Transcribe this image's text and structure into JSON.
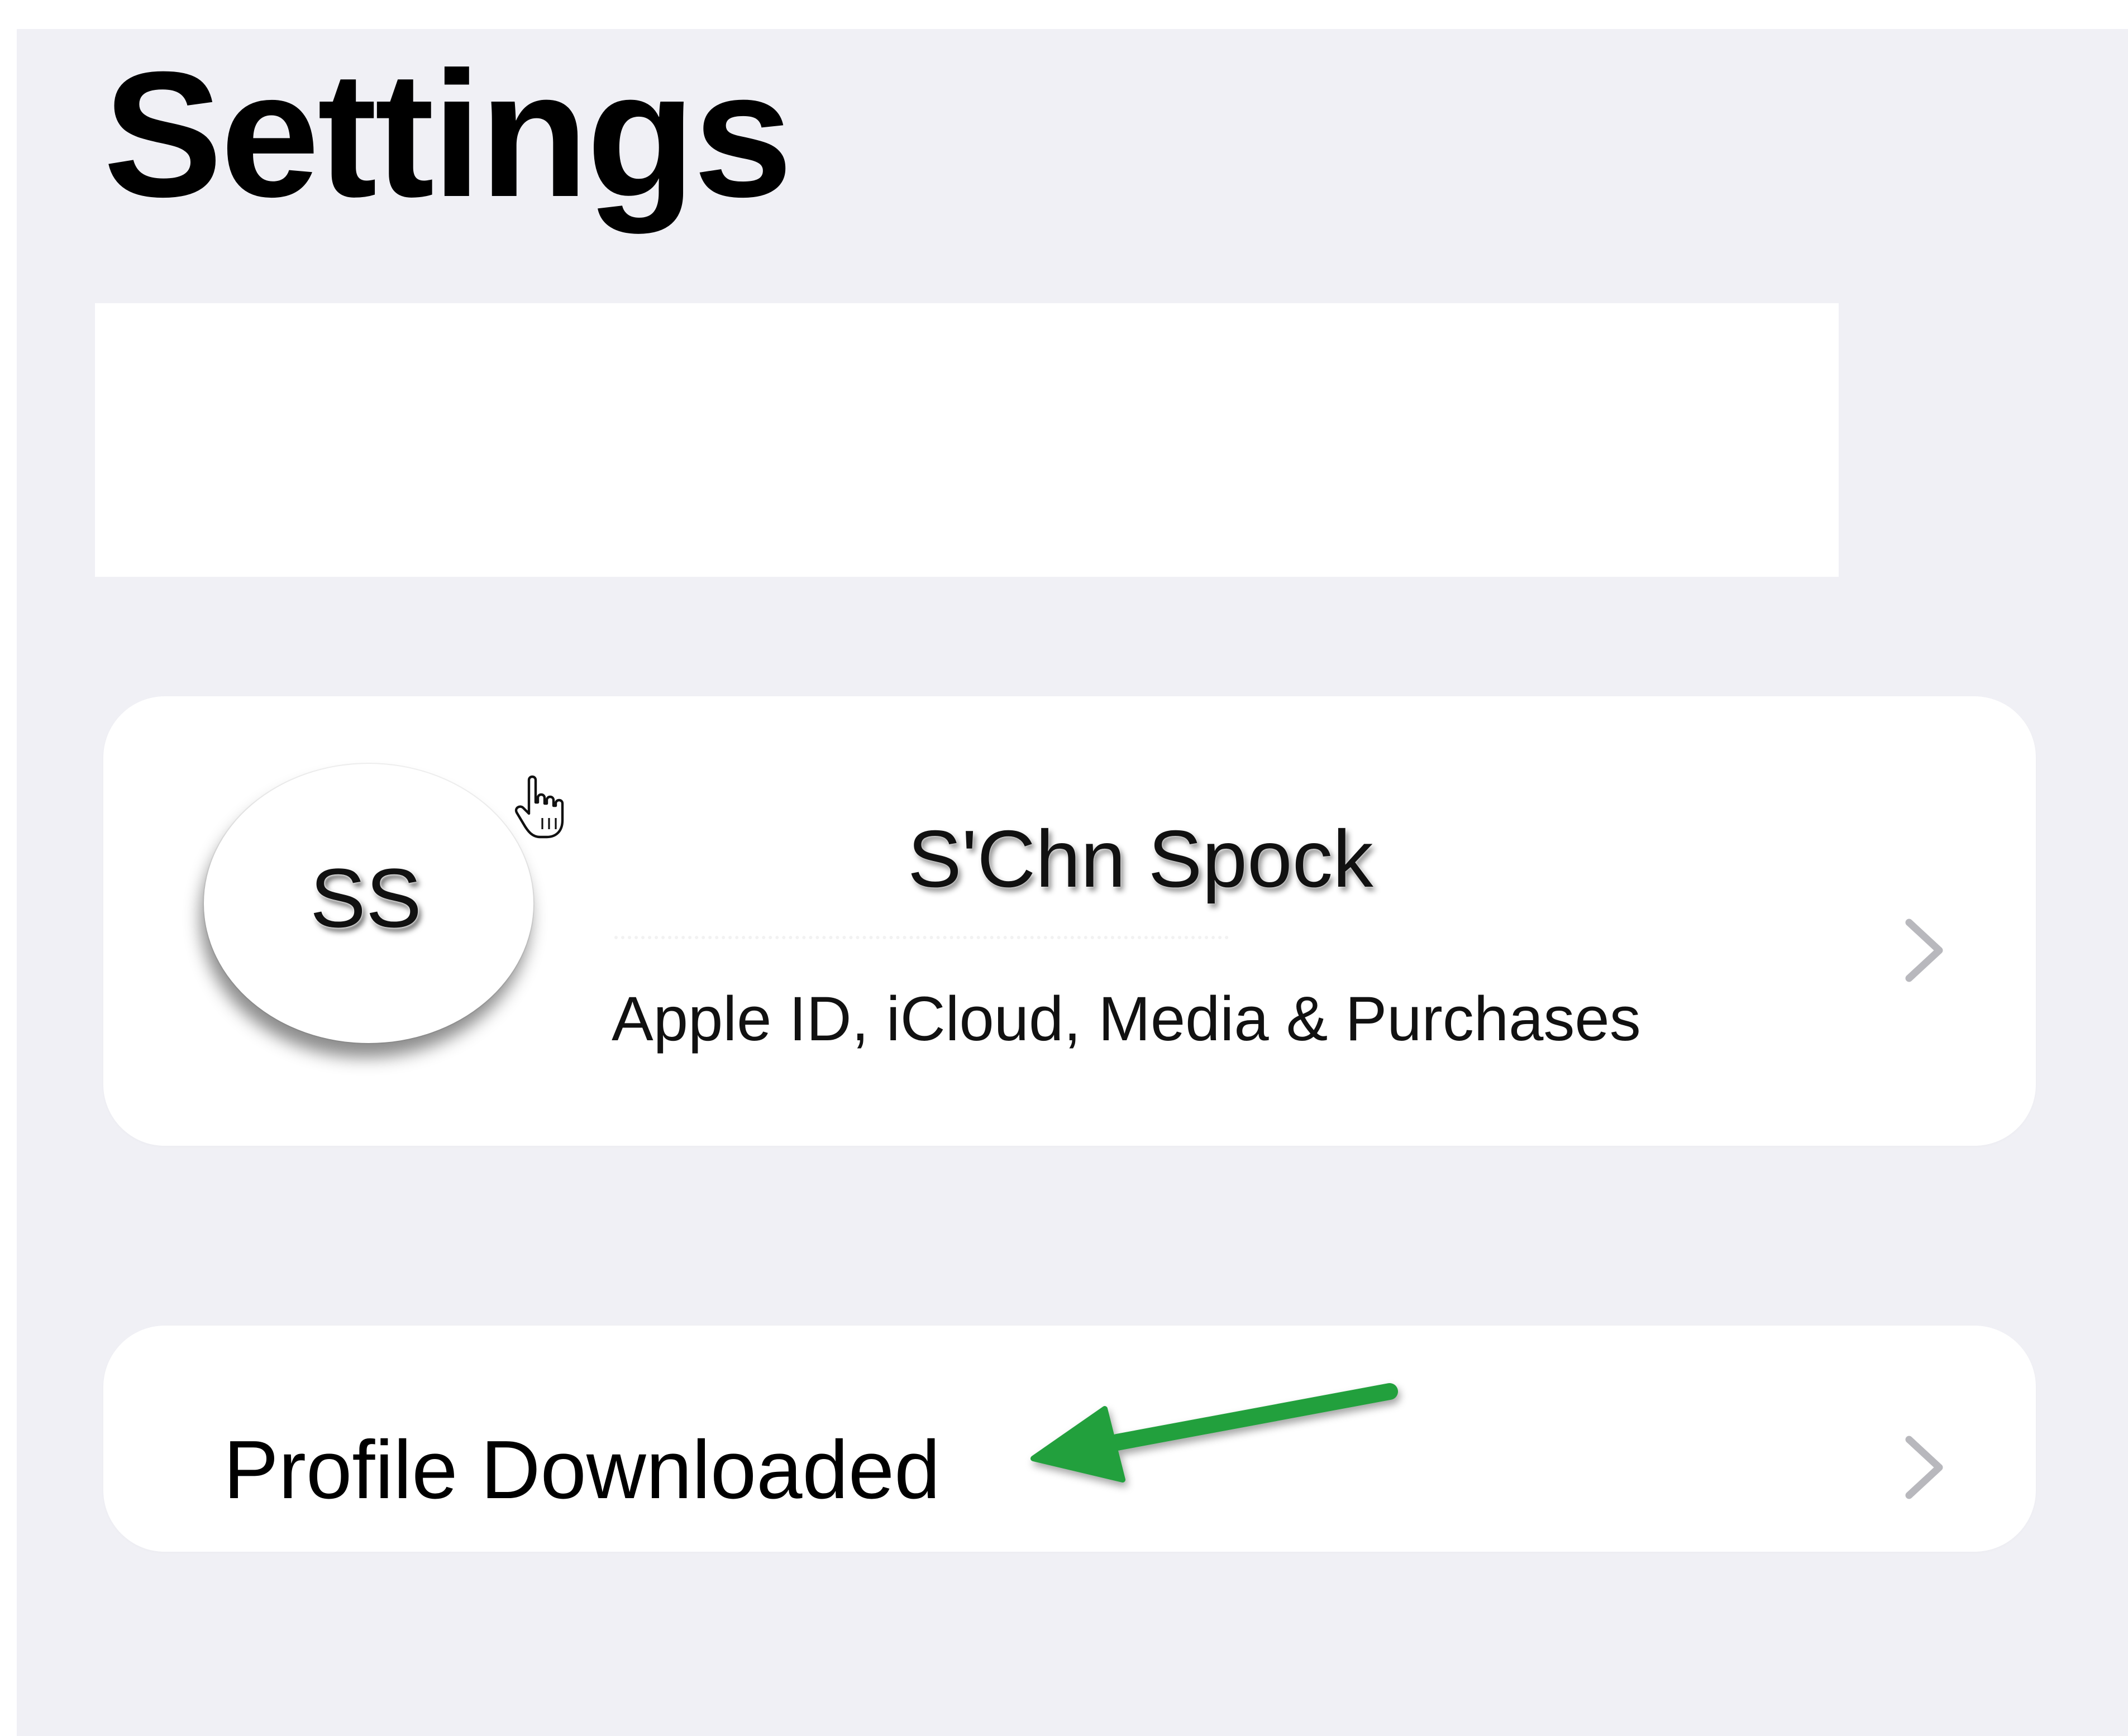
{
  "page": {
    "title": "Settings"
  },
  "account": {
    "initials": "SS",
    "name": "S'Chn Spock",
    "subtitle": "Apple ID, iCloud, Media & Purchases"
  },
  "profile_row": {
    "label": "Profile Downloaded"
  },
  "icons": {
    "chevron": "chevron-right-icon",
    "cursor": "hand-pointer-icon",
    "annotation": "green-arrow-icon"
  },
  "colors": {
    "background": "#f0f0f5",
    "card": "#ffffff",
    "chevron": "#b8b8bd",
    "annotation_arrow": "#22a03c"
  }
}
